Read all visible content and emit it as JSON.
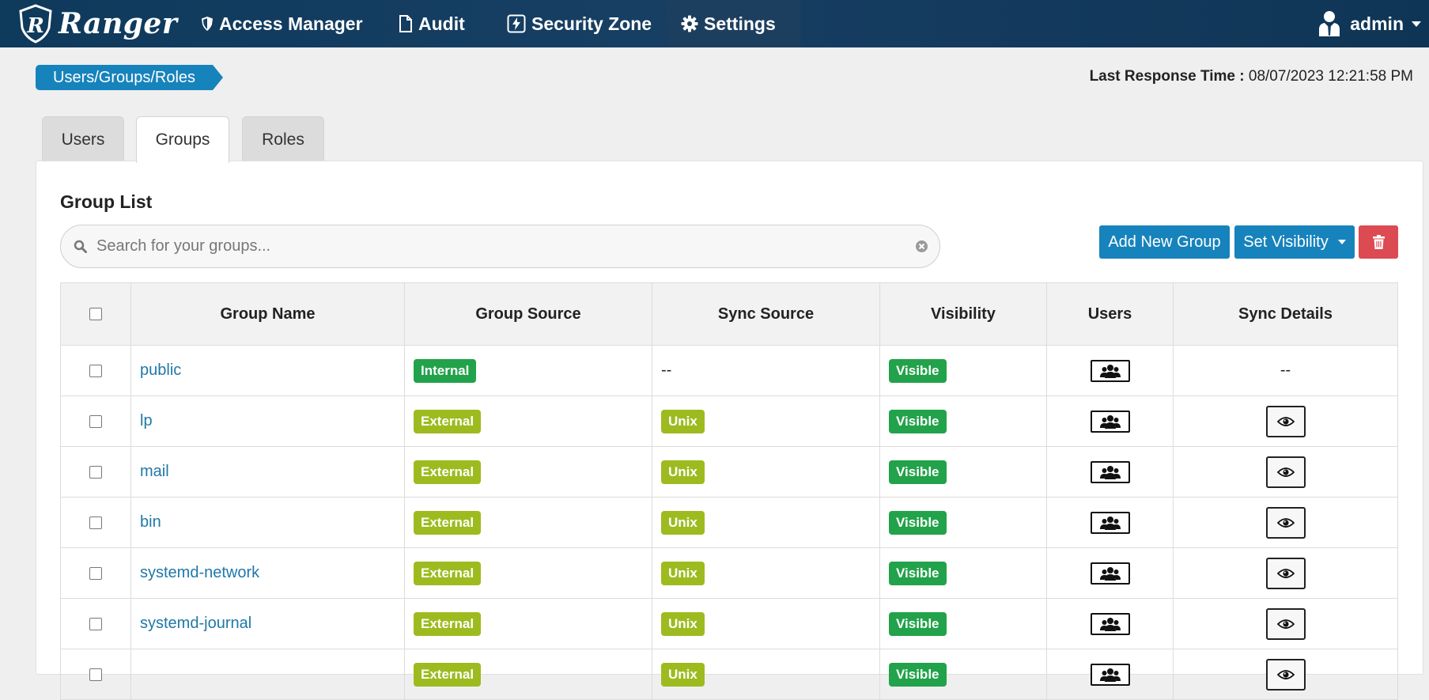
{
  "nav": {
    "brand": "Ranger",
    "items": [
      {
        "label": "Access Manager",
        "icon": "shield-icon"
      },
      {
        "label": "Audit",
        "icon": "file-icon"
      },
      {
        "label": "Security Zone",
        "icon": "lightning-icon"
      },
      {
        "label": "Settings",
        "icon": "gear-icon"
      }
    ],
    "user": "admin"
  },
  "breadcrumb": "Users/Groups/Roles",
  "response": {
    "label": "Last Response Time :",
    "value": "08/07/2023 12:21:58 PM"
  },
  "tabs": [
    {
      "label": "Users"
    },
    {
      "label": "Groups",
      "active": true
    },
    {
      "label": "Roles"
    }
  ],
  "panel": {
    "title": "Group List",
    "search_placeholder": "Search for your groups...",
    "add_label": "Add New Group",
    "visibility_label": "Set Visibility"
  },
  "table": {
    "headers": [
      "Group Name",
      "Group Source",
      "Sync Source",
      "Visibility",
      "Users",
      "Sync Details"
    ],
    "rows": [
      {
        "name": "public",
        "source": "Internal",
        "sync": "--",
        "visibility": "Visible",
        "details": "--"
      },
      {
        "name": "lp",
        "source": "External",
        "sync": "Unix",
        "visibility": "Visible",
        "details": ""
      },
      {
        "name": "mail",
        "source": "External",
        "sync": "Unix",
        "visibility": "Visible",
        "details": ""
      },
      {
        "name": "bin",
        "source": "External",
        "sync": "Unix",
        "visibility": "Visible",
        "details": ""
      },
      {
        "name": "systemd-network",
        "source": "External",
        "sync": "Unix",
        "visibility": "Visible",
        "details": ""
      },
      {
        "name": "systemd-journal",
        "source": "External",
        "sync": "Unix",
        "visibility": "Visible",
        "details": ""
      },
      {
        "name": "",
        "source": "External",
        "sync": "Unix",
        "visibility": "Visible",
        "details": ""
      }
    ]
  },
  "colors": {
    "navbar": "#173f63",
    "primary": "#1783bc",
    "danger": "#dc4a52",
    "badge_green": "#22a24a",
    "badge_olive": "#9dbb1f",
    "link": "#1f78a8"
  }
}
